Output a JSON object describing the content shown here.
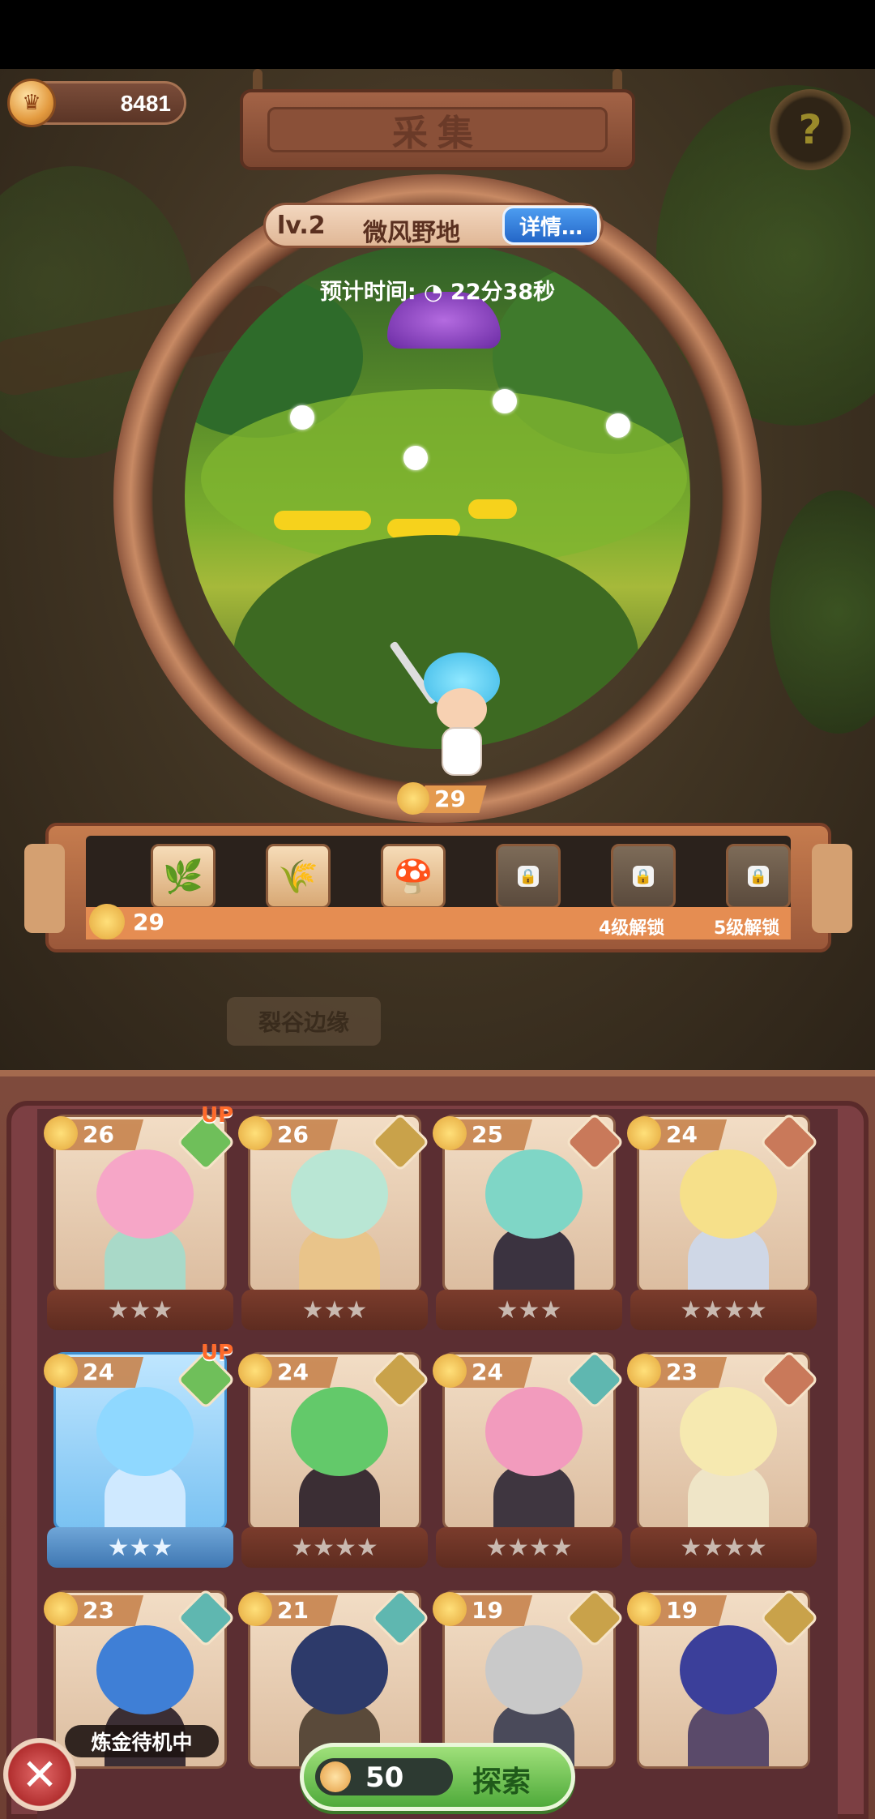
{
  "header": {
    "coins": "8481",
    "title": "采集"
  },
  "location": {
    "level": "lv.2",
    "name": "微风野地",
    "detail_button": "详情…",
    "eta_label": "预计时间:",
    "eta_value": "22分38秒"
  },
  "gather_badge": {
    "value": "29"
  },
  "materials": {
    "current": "29",
    "slots": [
      {
        "icon": "herb-icon",
        "locked": false
      },
      {
        "icon": "golden-grain-icon",
        "locked": false
      },
      {
        "icon": "red-mushroom-icon",
        "locked": false
      },
      {
        "icon": "blue-flower-icon",
        "locked": true
      },
      {
        "icon": "white-flower-icon",
        "locked": true,
        "unlock_text": "4级解锁"
      },
      {
        "icon": "seed-icon",
        "locked": true,
        "unlock_text": "5级解锁"
      }
    ]
  },
  "background_sign": "裂谷边缘",
  "heroes": [
    {
      "level": "26",
      "stars": "★★★",
      "up": "UP",
      "element": "leaf"
    },
    {
      "level": "26",
      "stars": "★★★",
      "element": "earth"
    },
    {
      "level": "25",
      "stars": "★★★",
      "element": "fire"
    },
    {
      "level": "24",
      "stars": "★★★★",
      "element": "fire"
    },
    {
      "level": "24",
      "stars": "★★★",
      "up": "UP",
      "element": "leaf",
      "selected": true
    },
    {
      "level": "24",
      "stars": "★★★★",
      "element": "earth"
    },
    {
      "level": "24",
      "stars": "★★★★",
      "element": "water"
    },
    {
      "level": "23",
      "stars": "★★★★",
      "element": "fire"
    },
    {
      "level": "23",
      "element": "water"
    },
    {
      "level": "21",
      "element": "water"
    },
    {
      "level": "19",
      "element": "earth"
    },
    {
      "level": "19",
      "element": "earth"
    }
  ],
  "status": "炼金待机中",
  "explore": {
    "cost": "50",
    "label": "探索"
  },
  "colors": {
    "leaf": "#6fbf5a",
    "earth": "#c9a24a",
    "fire": "#c9795a",
    "water": "#5fb7b0"
  }
}
